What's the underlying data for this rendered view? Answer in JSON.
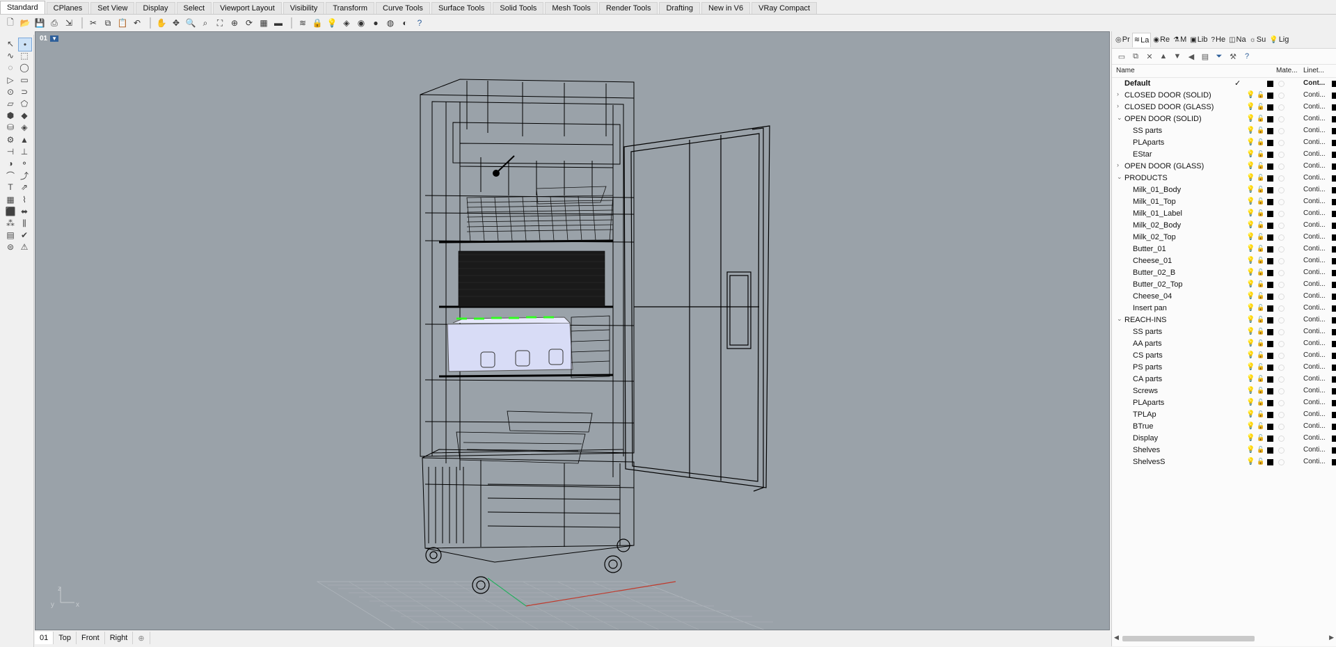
{
  "tabs": [
    "Standard",
    "CPlanes",
    "Set View",
    "Display",
    "Select",
    "Viewport Layout",
    "Visibility",
    "Transform",
    "Curve Tools",
    "Surface Tools",
    "Solid Tools",
    "Mesh Tools",
    "Render Tools",
    "Drafting",
    "New in V6",
    "VRay Compact"
  ],
  "toolbar_icons": [
    "new-icon",
    "open-icon",
    "save-icon",
    "print-icon",
    "import-icon",
    "cut-icon",
    "copy-icon",
    "paste-icon",
    "undo-icon",
    "pan-icon",
    "move-view-icon",
    "zoom-icon",
    "zoom-window-icon",
    "zoom-extents-icon",
    "zoom-selected-icon",
    "rotate-view-icon",
    "grid-icon",
    "cplane-icon",
    "layer-icon",
    "lock-icon",
    "light-icon",
    "material-icon",
    "color-icon",
    "render-icon",
    "sphere-icon",
    "shade-icon",
    "help-icon"
  ],
  "viewport": {
    "title": "01",
    "axis_labels": {
      "z": "z",
      "y": "y",
      "x": "x"
    }
  },
  "viewport_tabs": [
    "01",
    "Top",
    "Front",
    "Right"
  ],
  "panel_tabs": [
    {
      "icon": "properties-icon",
      "label": "Pr"
    },
    {
      "icon": "layers-icon",
      "label": "La"
    },
    {
      "icon": "render-icon",
      "label": "Re"
    },
    {
      "icon": "materials-icon",
      "label": "M"
    },
    {
      "icon": "library-icon",
      "label": "Lib"
    },
    {
      "icon": "help-icon",
      "label": "He"
    },
    {
      "icon": "named-views-icon",
      "label": "Na"
    },
    {
      "icon": "sun-icon",
      "label": "Su"
    },
    {
      "icon": "lights-icon",
      "label": "Lig"
    }
  ],
  "layer_columns": {
    "name": "Name",
    "material": "Mate...",
    "linetype": "Linet..."
  },
  "layers": [
    {
      "name": "Default",
      "level": 0,
      "bold": true,
      "current": true,
      "linetype": "Cont...",
      "bulb_on": true,
      "chevron": ""
    },
    {
      "name": "CLOSED DOOR (SOLID)",
      "level": 0,
      "bold": false,
      "current": false,
      "linetype": "Conti...",
      "bulb_on": false,
      "chevron": "›"
    },
    {
      "name": "CLOSED DOOR (GLASS)",
      "level": 0,
      "bold": false,
      "current": false,
      "linetype": "Conti...",
      "bulb_on": false,
      "chevron": "›"
    },
    {
      "name": "OPEN DOOR (SOLID)",
      "level": 0,
      "bold": false,
      "current": false,
      "linetype": "Conti...",
      "bulb_on": true,
      "chevron": "⌄"
    },
    {
      "name": "SS parts",
      "level": 1,
      "bold": false,
      "current": false,
      "linetype": "Conti...",
      "bulb_on": true,
      "chevron": ""
    },
    {
      "name": "PLAparts",
      "level": 1,
      "bold": false,
      "current": false,
      "linetype": "Conti...",
      "bulb_on": true,
      "chevron": ""
    },
    {
      "name": "EStar",
      "level": 1,
      "bold": false,
      "current": false,
      "linetype": "Conti...",
      "bulb_on": true,
      "chevron": ""
    },
    {
      "name": "OPEN DOOR (GLASS)",
      "level": 0,
      "bold": false,
      "current": false,
      "linetype": "Conti...",
      "bulb_on": false,
      "chevron": "›"
    },
    {
      "name": "PRODUCTS",
      "level": 0,
      "bold": false,
      "current": false,
      "linetype": "Conti...",
      "bulb_on": true,
      "chevron": "⌄"
    },
    {
      "name": "Milk_01_Body",
      "level": 1,
      "bold": false,
      "current": false,
      "linetype": "Conti...",
      "bulb_on": true,
      "chevron": ""
    },
    {
      "name": "Milk_01_Top",
      "level": 1,
      "bold": false,
      "current": false,
      "linetype": "Conti...",
      "bulb_on": true,
      "chevron": ""
    },
    {
      "name": "Milk_01_Label",
      "level": 1,
      "bold": false,
      "current": false,
      "linetype": "Conti...",
      "bulb_on": true,
      "chevron": ""
    },
    {
      "name": "Milk_02_Body",
      "level": 1,
      "bold": false,
      "current": false,
      "linetype": "Conti...",
      "bulb_on": true,
      "chevron": ""
    },
    {
      "name": "Milk_02_Top",
      "level": 1,
      "bold": false,
      "current": false,
      "linetype": "Conti...",
      "bulb_on": true,
      "chevron": ""
    },
    {
      "name": "Butter_01",
      "level": 1,
      "bold": false,
      "current": false,
      "linetype": "Conti...",
      "bulb_on": true,
      "chevron": ""
    },
    {
      "name": "Cheese_01",
      "level": 1,
      "bold": false,
      "current": false,
      "linetype": "Conti...",
      "bulb_on": true,
      "chevron": ""
    },
    {
      "name": "Butter_02_B",
      "level": 1,
      "bold": false,
      "current": false,
      "linetype": "Conti...",
      "bulb_on": true,
      "chevron": ""
    },
    {
      "name": "Butter_02_Top",
      "level": 1,
      "bold": false,
      "current": false,
      "linetype": "Conti...",
      "bulb_on": true,
      "chevron": ""
    },
    {
      "name": "Cheese_04",
      "level": 1,
      "bold": false,
      "current": false,
      "linetype": "Conti...",
      "bulb_on": true,
      "chevron": ""
    },
    {
      "name": "Insert pan",
      "level": 1,
      "bold": false,
      "current": false,
      "linetype": "Conti...",
      "bulb_on": true,
      "chevron": ""
    },
    {
      "name": "REACH-INS",
      "level": 0,
      "bold": false,
      "current": false,
      "linetype": "Conti...",
      "bulb_on": true,
      "chevron": "⌄"
    },
    {
      "name": "SS parts",
      "level": 1,
      "bold": false,
      "current": false,
      "linetype": "Conti...",
      "bulb_on": true,
      "chevron": ""
    },
    {
      "name": "AA parts",
      "level": 1,
      "bold": false,
      "current": false,
      "linetype": "Conti...",
      "bulb_on": true,
      "chevron": ""
    },
    {
      "name": "CS parts",
      "level": 1,
      "bold": false,
      "current": false,
      "linetype": "Conti...",
      "bulb_on": true,
      "chevron": ""
    },
    {
      "name": "PS parts",
      "level": 1,
      "bold": false,
      "current": false,
      "linetype": "Conti...",
      "bulb_on": true,
      "chevron": ""
    },
    {
      "name": "CA parts",
      "level": 1,
      "bold": false,
      "current": false,
      "linetype": "Conti...",
      "bulb_on": true,
      "chevron": ""
    },
    {
      "name": "Screws",
      "level": 1,
      "bold": false,
      "current": false,
      "linetype": "Conti...",
      "bulb_on": true,
      "chevron": ""
    },
    {
      "name": "PLAparts",
      "level": 1,
      "bold": false,
      "current": false,
      "linetype": "Conti...",
      "bulb_on": true,
      "chevron": ""
    },
    {
      "name": "TPLAp",
      "level": 1,
      "bold": false,
      "current": false,
      "linetype": "Conti...",
      "bulb_on": true,
      "chevron": ""
    },
    {
      "name": "BTrue",
      "level": 1,
      "bold": false,
      "current": false,
      "linetype": "Conti...",
      "bulb_on": true,
      "chevron": ""
    },
    {
      "name": "Display",
      "level": 1,
      "bold": false,
      "current": false,
      "linetype": "Conti...",
      "bulb_on": true,
      "chevron": ""
    },
    {
      "name": "Shelves",
      "level": 1,
      "bold": false,
      "current": false,
      "linetype": "Conti...",
      "bulb_on": true,
      "chevron": ""
    },
    {
      "name": "ShelvesS",
      "level": 1,
      "bold": false,
      "current": false,
      "linetype": "Conti...",
      "bulb_on": true,
      "chevron": ""
    }
  ],
  "colors": {
    "viewport_bg": "#9aa2a9",
    "accent": "#2e5f9a",
    "highlight": "#31ff1f"
  }
}
